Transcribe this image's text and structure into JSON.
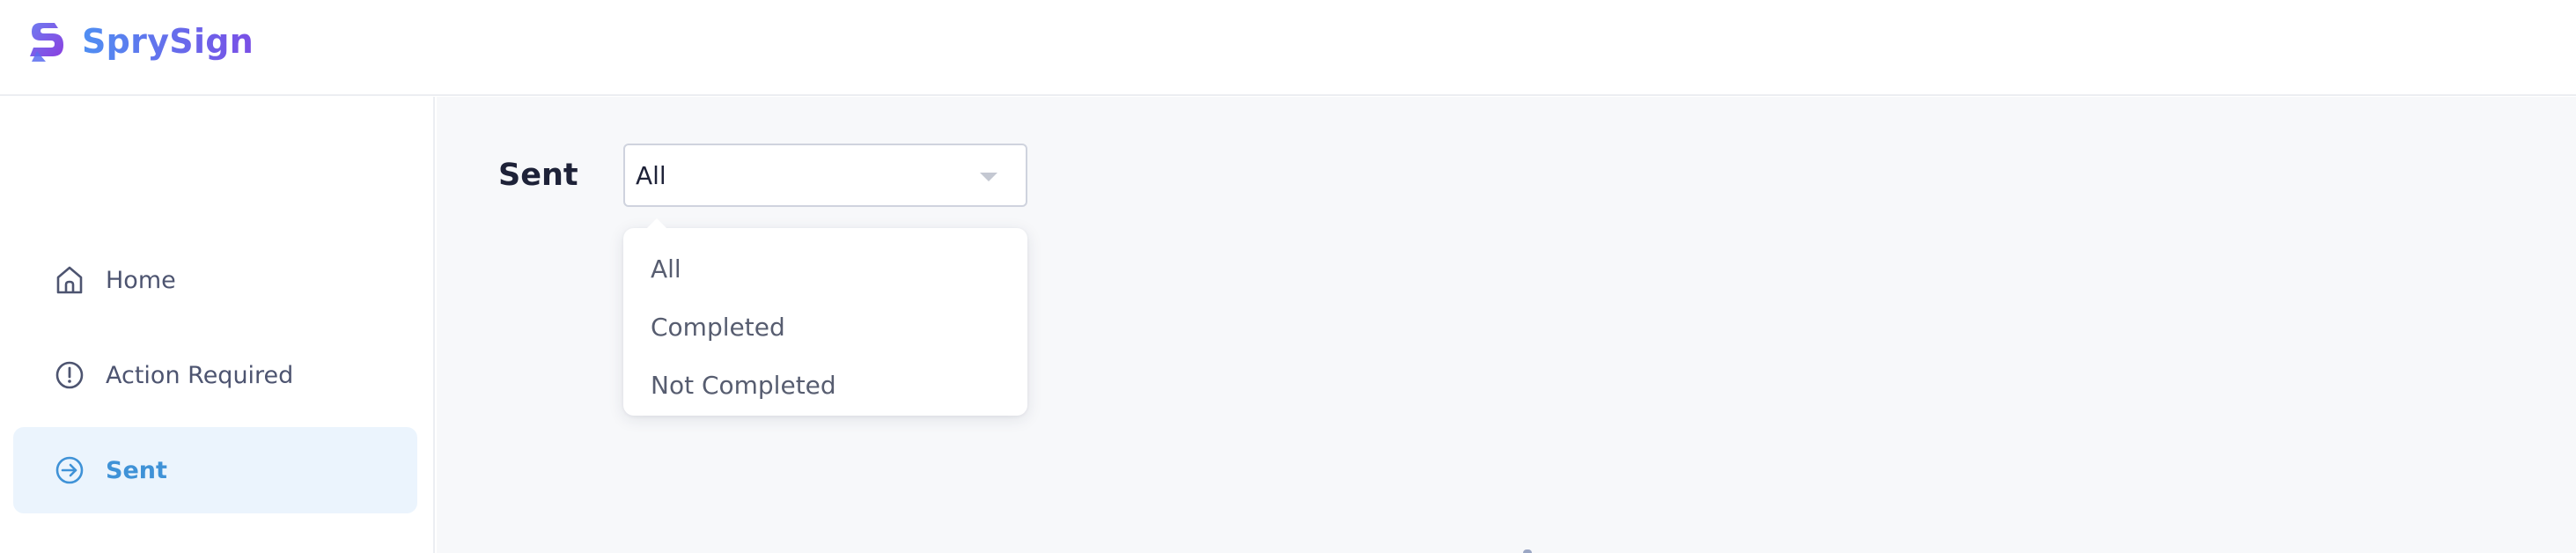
{
  "app": {
    "name": "SprySign",
    "logo_icon": "s-logo-icon",
    "brand_colors": [
      "#4f8ff2",
      "#7a4fe6"
    ]
  },
  "sidebar": {
    "items": [
      {
        "label": "Home",
        "icon": "home-icon",
        "active": false
      },
      {
        "label": "Action Required",
        "icon": "alert-circle-icon",
        "active": false
      },
      {
        "label": "Sent",
        "icon": "sent-arrow-icon",
        "active": true
      }
    ],
    "active_color": "#3f92d7",
    "active_background": "#ebf4fd"
  },
  "main": {
    "title": "Sent",
    "filter": {
      "selected": "All",
      "icon": "chevron-down-icon",
      "options": [
        "All",
        "Completed",
        "Not Completed"
      ],
      "open": true
    }
  }
}
